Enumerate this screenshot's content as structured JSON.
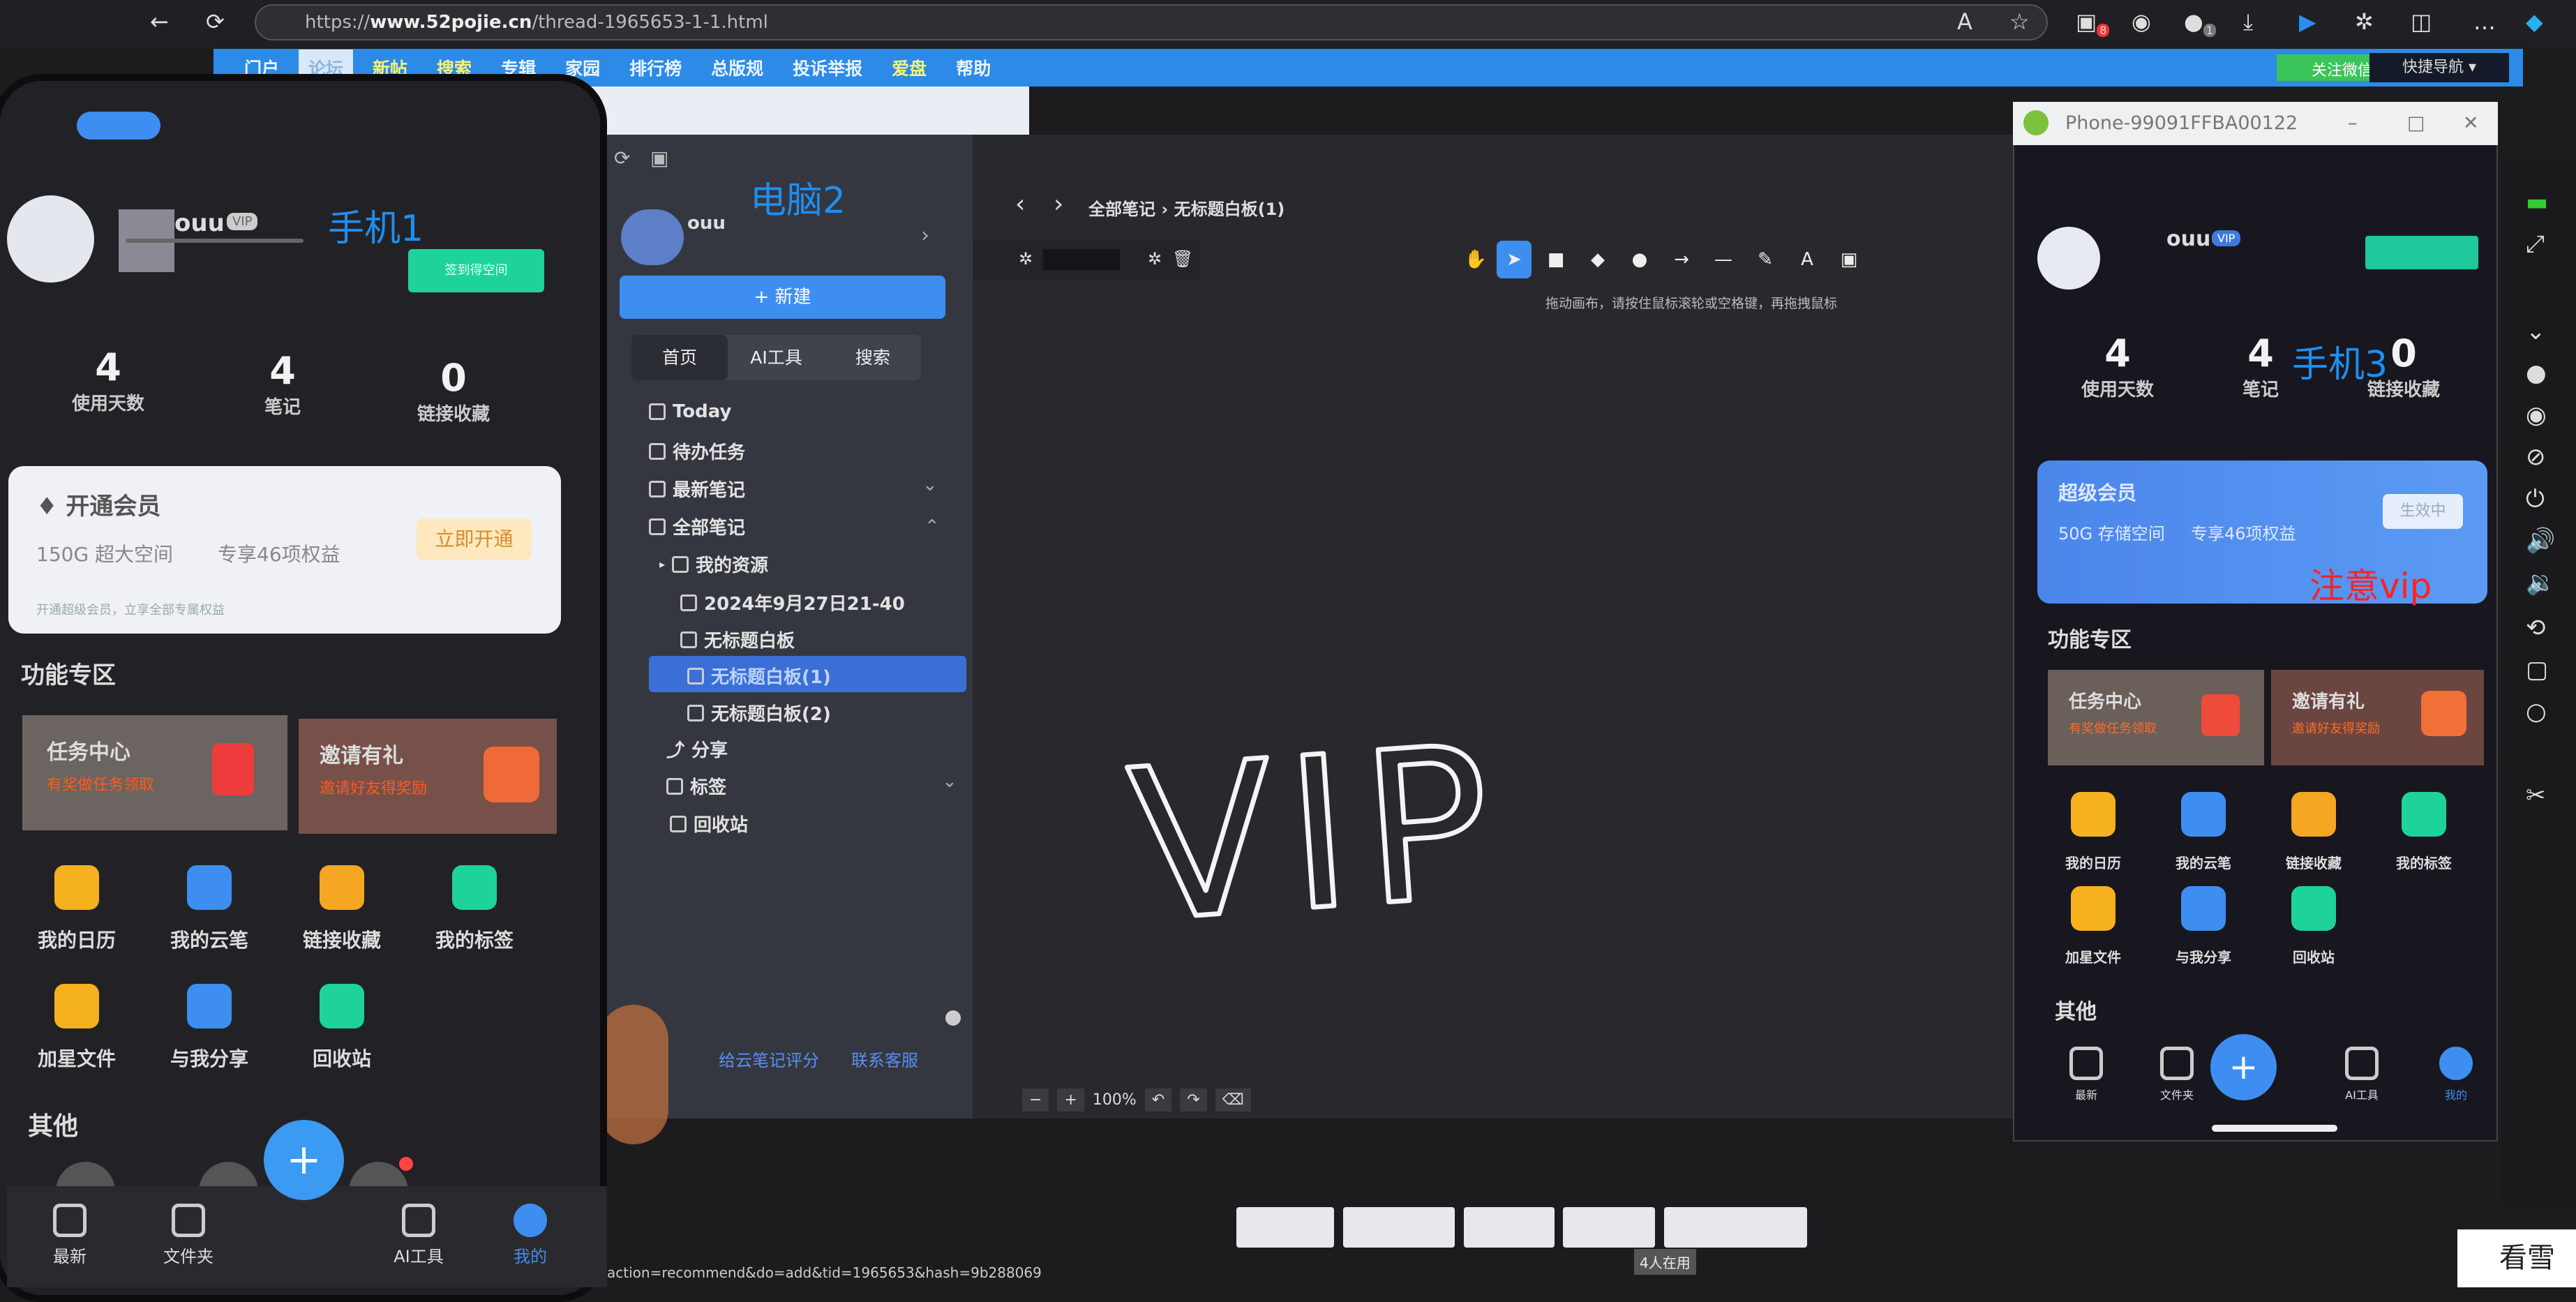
{
  "browser": {
    "url_prefix": "https://",
    "url_domain": "www.52pojie.cn",
    "url_path": "/thread-1965653-1-1.html",
    "ext_badges": [
      "8",
      "1"
    ]
  },
  "site_nav": {
    "items": [
      "门户",
      "论坛",
      "新帖",
      "搜索",
      "专辑",
      "家园",
      "排行榜",
      "总版规",
      "投诉举报",
      "爱盘",
      "帮助"
    ],
    "wechat": "关注微信",
    "quick_nav": "快捷导航 ▾"
  },
  "annotations": {
    "phone1": "手机1",
    "pc2": "电脑2",
    "phone3": "手机3",
    "note": "注意vip"
  },
  "pc_app": {
    "username": "ouu",
    "new_button": "+ 新建",
    "tabs": [
      "首页",
      "AI工具",
      "搜索"
    ],
    "tree": [
      "Today",
      "待办任务",
      "最新笔记",
      "全部笔记",
      "我的资源",
      "2024年9月27日21-40",
      "无标题白板",
      "无标题白板(1)",
      "无标题白板(2)",
      "分享",
      "标签",
      "回收站"
    ],
    "footer_links": [
      "给云笔记评分",
      "联系客服"
    ],
    "breadcrumb": [
      "全部笔记",
      "无标题白板(1)"
    ],
    "hint": "拖动画布，请按住鼠标滚轮或空格键，再拖拽鼠标",
    "zoom": "100%",
    "drawing_text": "VIP"
  },
  "phone1": {
    "username": "ouu",
    "vip_badge": "VIP",
    "sign_button": "签到得空间",
    "stats": [
      {
        "n": "4",
        "l": "使用天数"
      },
      {
        "n": "4",
        "l": "笔记"
      },
      {
        "n": "0",
        "l": "链接收藏"
      }
    ],
    "member_card": {
      "title": "开通会员",
      "space": "150G 超大空间",
      "benefits": "专享46项权益",
      "button": "立即开通",
      "footer": "开通超级会员，立享全部专属权益"
    },
    "section": "功能专区",
    "cards": [
      {
        "title": "任务中心",
        "sub": "有奖做任务领取"
      },
      {
        "title": "邀请有礼",
        "sub": "邀请好友得奖励"
      }
    ],
    "features": [
      "我的日历",
      "我的云笔",
      "链接收藏",
      "我的标签",
      "加星文件",
      "与我分享",
      "回收站"
    ],
    "other": "其他",
    "nav": [
      "最新",
      "文件夹",
      "AI工具",
      "我的"
    ]
  },
  "phone3": {
    "window_title": "Phone-99091FFBA00122",
    "username": "ouu",
    "vip_badge": "VIP",
    "stats": [
      {
        "n": "4",
        "l": "使用天数"
      },
      {
        "n": "4",
        "l": "笔记"
      },
      {
        "n": "0",
        "l": "链接收藏"
      }
    ],
    "member_card": {
      "title": "超级会员",
      "space": "50G 存储空间",
      "benefits": "专享46项权益",
      "button": "生效中"
    },
    "section": "功能专区",
    "cards": [
      {
        "title": "任务中心",
        "sub": "有奖做任务领取"
      },
      {
        "title": "邀请有礼",
        "sub": "邀请好友得奖励"
      }
    ],
    "features": [
      "我的日历",
      "我的云笔",
      "链接收藏",
      "我的标签",
      "加星文件",
      "与我分享",
      "回收站"
    ],
    "other": "其他",
    "nav": [
      "最新",
      "文件夹",
      "AI工具",
      "我的"
    ]
  },
  "status": {
    "url": "action=recommend&do=add&tid=1965653&hash=9b288069",
    "users": "4人在用"
  },
  "watermark": "看雪",
  "colors": {
    "accent": "#3d8ef0",
    "nav": "#2d8ae6",
    "green": "#1ed39a",
    "vip_card": "#4a8cf0",
    "annotation_blue": "#1e8ff0",
    "annotation_red": "#ff2222"
  }
}
